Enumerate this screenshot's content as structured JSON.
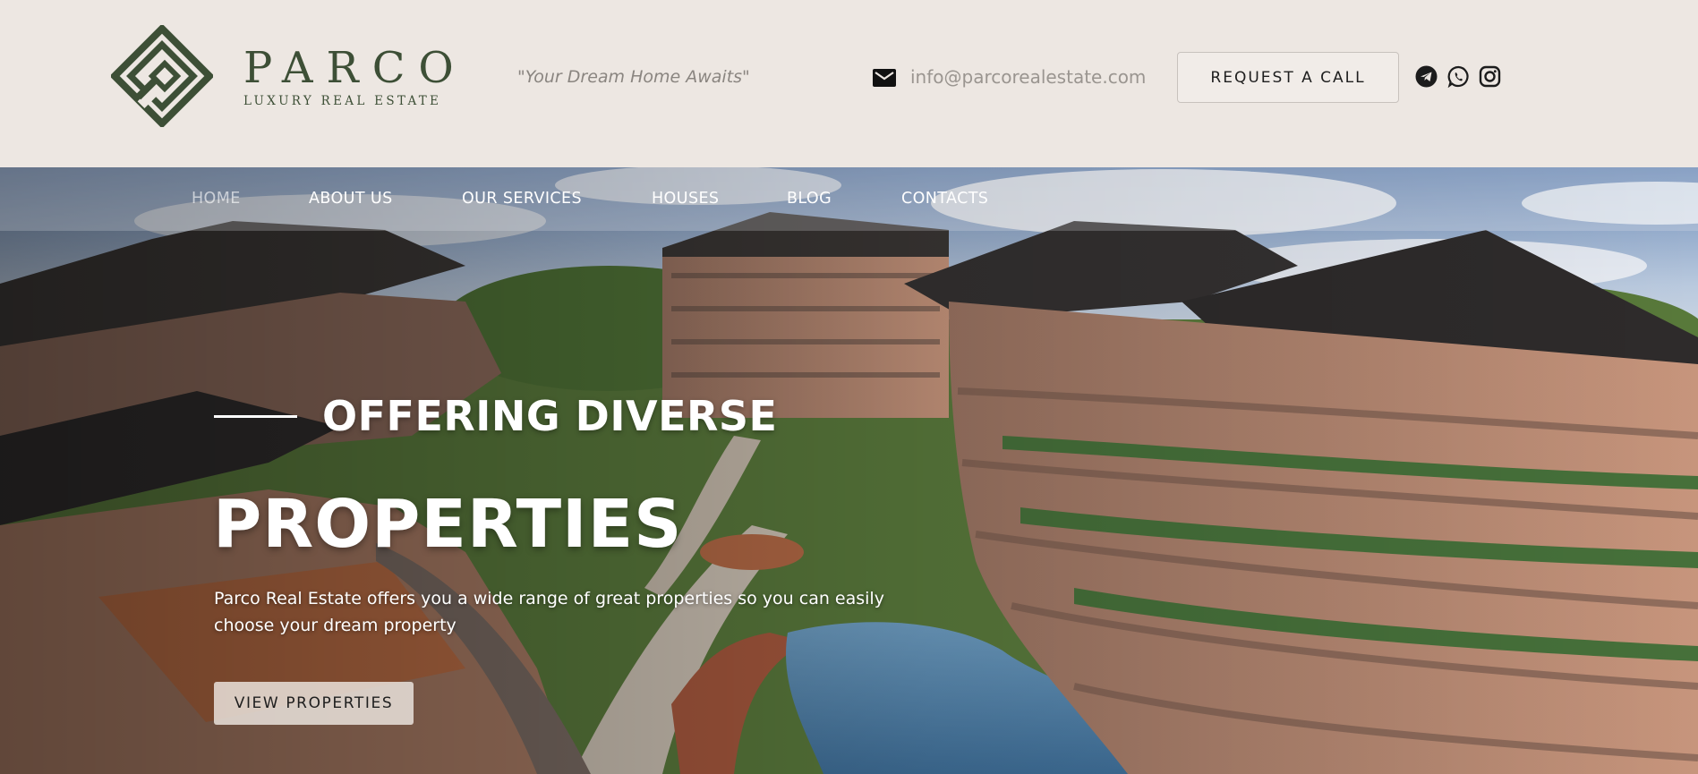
{
  "brand": {
    "name": "PARCO",
    "subtitle": "LUXURY REAL ESTATE",
    "color": "#3d4f36"
  },
  "header": {
    "tagline": "\"Your Dream Home Awaits\"",
    "email": "info@parcorealestate.com",
    "email_icon": "envelope-icon",
    "cta_label": "REQUEST A CALL",
    "social_icons": [
      "telegram-icon",
      "whatsapp-icon",
      "instagram-icon"
    ]
  },
  "nav": {
    "items": [
      {
        "label": "HOME",
        "active": true
      },
      {
        "label": "ABOUT US",
        "active": false
      },
      {
        "label": "OUR SERVICES",
        "active": false
      },
      {
        "label": "HOUSES",
        "active": false
      },
      {
        "label": "BLOG",
        "active": false
      },
      {
        "label": "CONTACTS",
        "active": false
      }
    ]
  },
  "hero": {
    "kicker": "OFFERING DIVERSE",
    "headline": "PROPERTIES",
    "description": "Parco Real Estate offers you a wide range of great properties so you can easily choose your dream property",
    "button_label": "VIEW PROPERTIES"
  },
  "colors": {
    "header_bg": "#ede7e2",
    "accent_green": "#3d4f36",
    "text_dark": "#1e1e1e"
  }
}
